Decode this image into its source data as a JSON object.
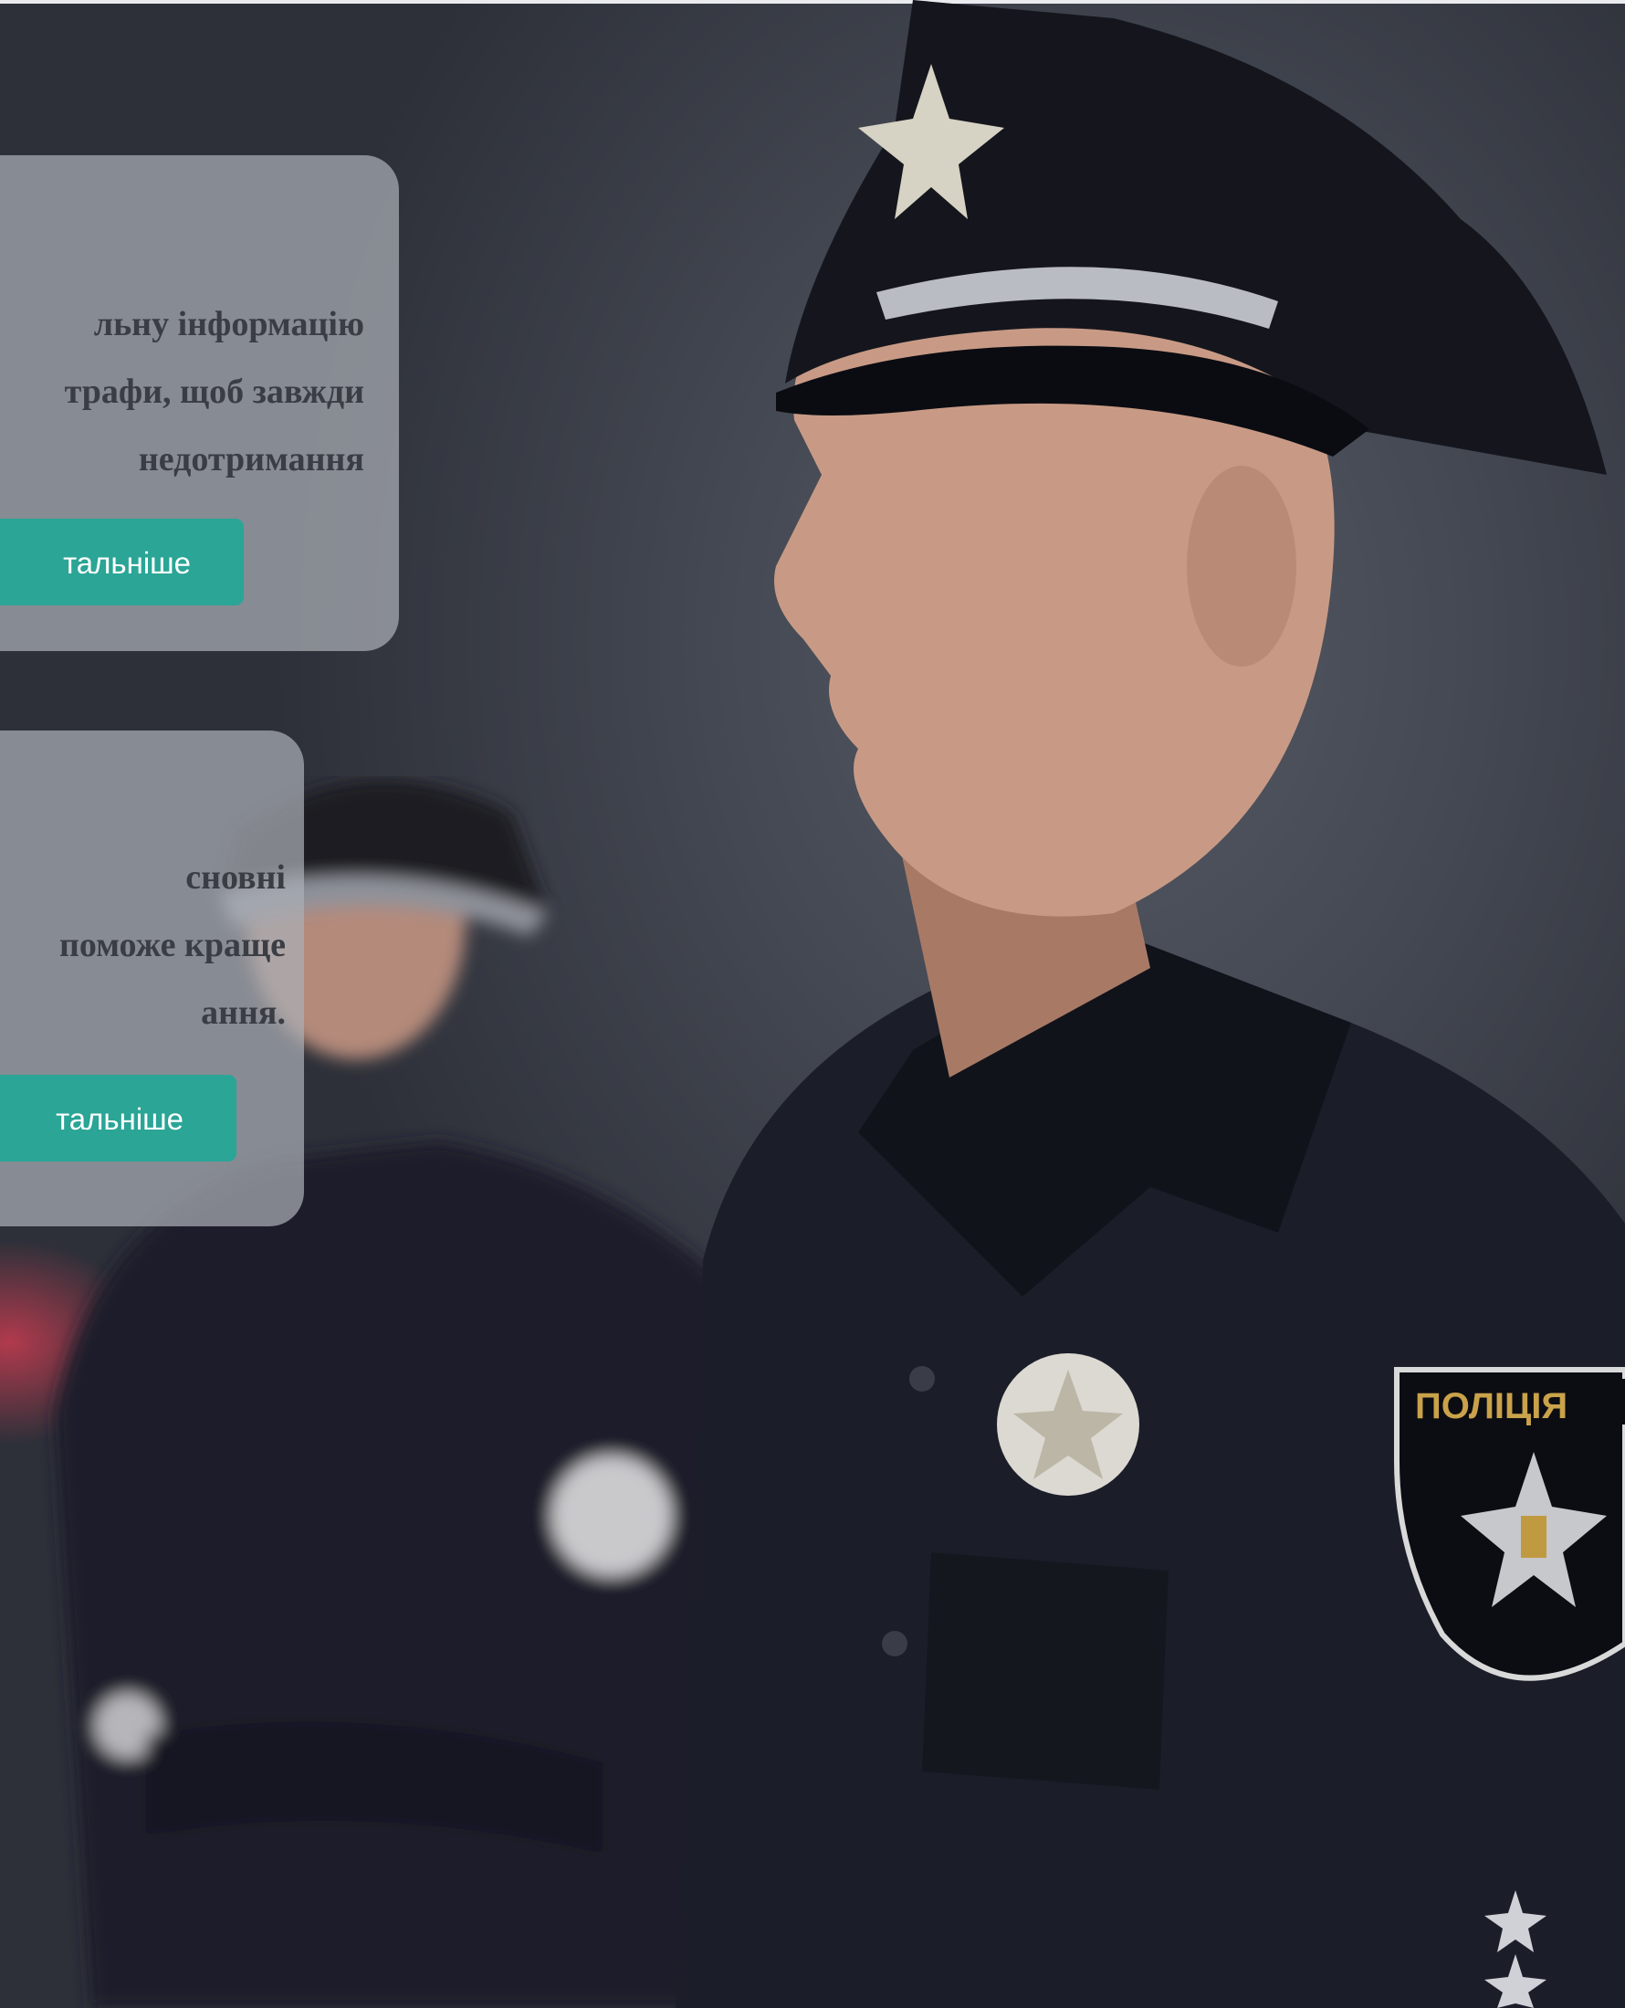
{
  "cards": [
    {
      "text_lines": [
        "льну інформацію",
        "трафи, щоб завжди",
        "недотримання"
      ],
      "button_label": "тальніше"
    },
    {
      "text_lines": [
        "сновні",
        "поможе краще",
        "ання."
      ],
      "button_label": "тальніше"
    }
  ],
  "background": {
    "badge_text": "ПОЛІЦІЯ",
    "accent_color": "#2aa596"
  }
}
